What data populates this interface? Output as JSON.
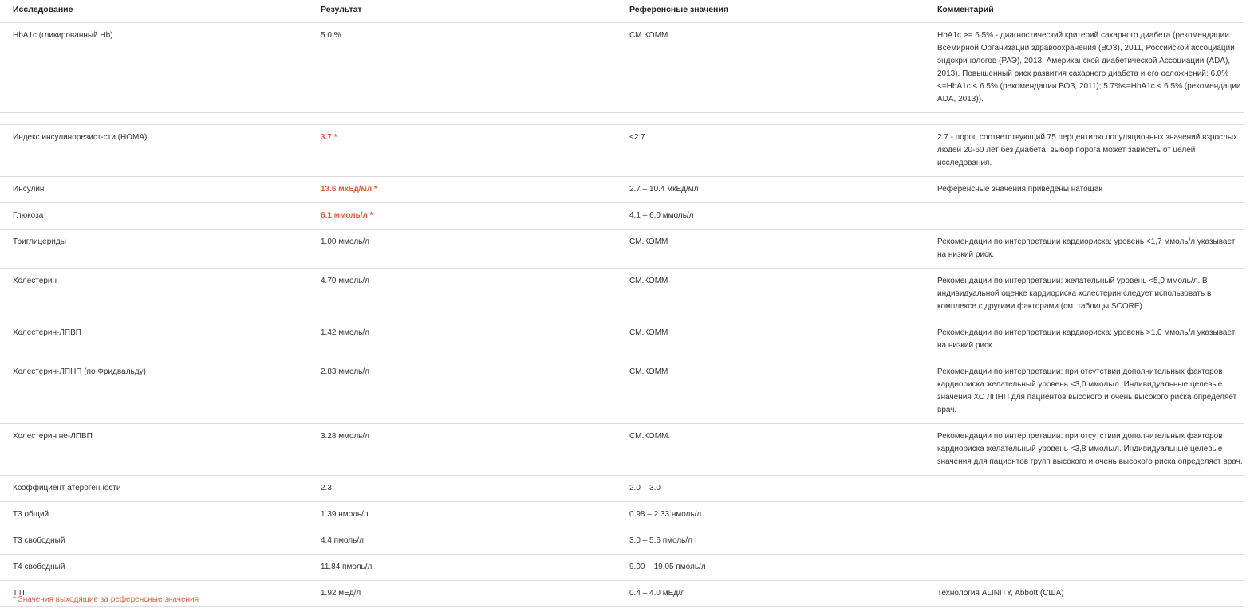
{
  "colors": {
    "text": "#333333",
    "abnormal": "#e8603c",
    "divider": "#dcdcdc",
    "background": "#ffffff"
  },
  "table": {
    "headers": {
      "study": "Исследование",
      "result": "Результат",
      "reference": "Референсные значения",
      "comment": "Комментарий"
    },
    "rows": [
      {
        "name": "HbA1c (гликированный Hb)",
        "result": "5.0 %",
        "abnormal": false,
        "reference": "СМ.КОММ.",
        "comment": "HbA1c >= 6.5% - диагностический критерий сахарного диабета (рекомендации Всемирной Организации здравоохранения (ВОЗ), 2011, Российской ассоциации эндокринологов (РАЭ), 2013, Американской диабетической Ассоциации (ADA), 2013). Повышенный риск развития сахарного диабета и его осложнений: 6.0% <=HbA1c < 6.5% (рекомендации ВОЗ, 2011); 5.7%<=HbA1c < 6.5% (рекомендации ADA, 2013))."
      },
      {
        "name": "Индекс инсулинорезист-сти (HOMA)",
        "result": "3.7 *",
        "abnormal": true,
        "reference": "<2.7",
        "comment": "2.7 - порог, соответствующий 75 перцентилю популяционных значений взрослых людей 20-60 лет без диабета, выбор порога может зависеть от целей исследования."
      },
      {
        "name": "Инсулин",
        "result": "13.6 мкЕд/мл *",
        "abnormal": true,
        "reference": "2.7 – 10.4 мкЕд/мл",
        "comment": "Референсные значения приведены натощак"
      },
      {
        "name": "Глюкоза",
        "result": "6.1 ммоль/л *",
        "abnormal": true,
        "reference": "4.1 – 6.0 ммоль/л",
        "comment": ""
      },
      {
        "name": "Триглицериды",
        "result": "1.00 ммоль/л",
        "abnormal": false,
        "reference": "СМ.КОММ",
        "comment": "Рекомендации по интерпретации кардиориска: уровень <1,7 ммоль/л указывает на низкий риск."
      },
      {
        "name": "Холестерин",
        "result": "4.70 ммоль/л",
        "abnormal": false,
        "reference": "СМ.КОММ",
        "comment": "Рекомендации по интерпретации: желательный уровень <5,0 ммоль/л. В индивидуальной оценке кардиориска холестерин следует использовать в комплексе с другими факторами (см. таблицы SCORE)."
      },
      {
        "name": "Холестерин-ЛПВП",
        "result": "1.42 ммоль/л",
        "abnormal": false,
        "reference": "СМ.КОММ",
        "comment": "Рекомендации по интерпретации кардиориска: уровень >1,0 ммоль/л указывает на низкий риск."
      },
      {
        "name": "Холестерин-ЛПНП (по Фридвальду)",
        "result": "2.83 ммоль/л",
        "abnormal": false,
        "reference": "СМ.КОММ",
        "comment": "Рекомендации по интерпретации: при отсутствии дополнительных факторов кардиориска желательный уровень <3,0 ммоль/л. Индивидуальные целевые значения ХС ЛПНП для пациентов высокого и очень высокого риска определяет врач."
      },
      {
        "name": "Холестерин не-ЛПВП",
        "result": "3.28 ммоль/л",
        "abnormal": false,
        "reference": "СМ.КОММ.",
        "comment": "Рекомендации по интерпретации: при отсутствии дополнительных факторов кардиориска желательный уровень <3,8 ммоль/л. Индивидуальные целевые значения для пациентов групп высокого и очень высокого риска определяет врач."
      },
      {
        "name": "Коэффициент атерогенности",
        "result": "2.3",
        "abnormal": false,
        "reference": "2.0 – 3.0",
        "comment": ""
      },
      {
        "name": "T3 общий",
        "result": "1.39 нмоль/л",
        "abnormal": false,
        "reference": "0.98 – 2.33 нмоль/л",
        "comment": ""
      },
      {
        "name": "T3 свободный",
        "result": "4.4 пмоль/л",
        "abnormal": false,
        "reference": "3.0 – 5.6 пмоль/л",
        "comment": ""
      },
      {
        "name": "T4 свободный",
        "result": "11.84 пмоль/л",
        "abnormal": false,
        "reference": "9.00 – 19.05 пмоль/л",
        "comment": ""
      },
      {
        "name": "ТТГ",
        "result": "1.92 мЕд/л",
        "abnormal": false,
        "reference": "0.4 – 4.0 мЕд/л",
        "comment": "Технология ALINITY, Abbott (США)"
      }
    ]
  },
  "footnote": "* Значения выходящие за референсные значения"
}
